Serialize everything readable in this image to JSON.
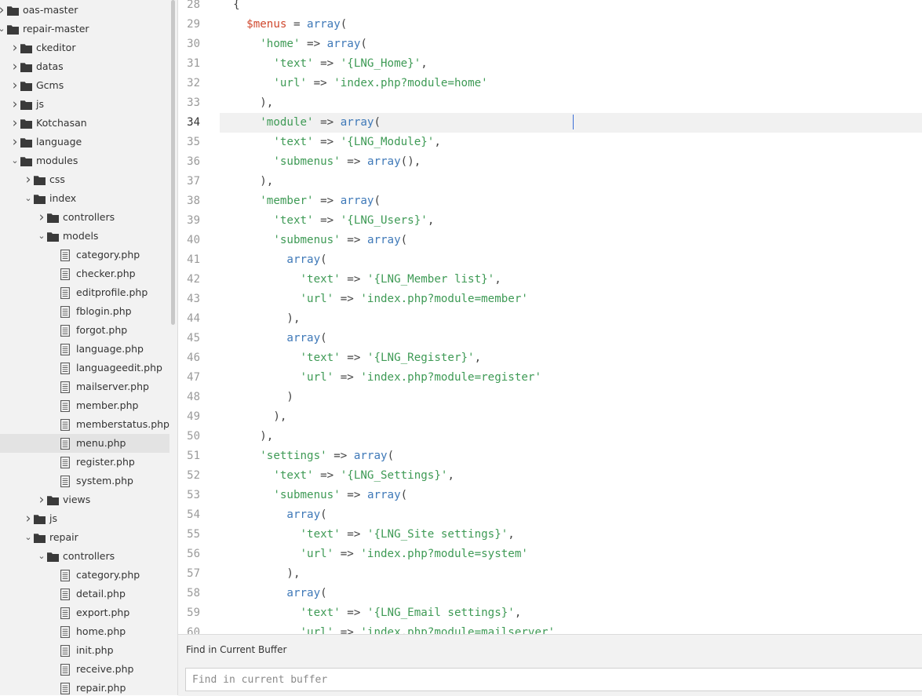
{
  "sidebar": {
    "tree": [
      {
        "label": "oas-master",
        "type": "folder",
        "depth": 0,
        "arrow": "right"
      },
      {
        "label": "repair-master",
        "type": "folder",
        "depth": 0,
        "arrow": "down"
      },
      {
        "label": "ckeditor",
        "type": "folder",
        "depth": 1,
        "arrow": "right"
      },
      {
        "label": "datas",
        "type": "folder",
        "depth": 1,
        "arrow": "right"
      },
      {
        "label": "Gcms",
        "type": "folder",
        "depth": 1,
        "arrow": "right"
      },
      {
        "label": "js",
        "type": "folder",
        "depth": 1,
        "arrow": "right"
      },
      {
        "label": "Kotchasan",
        "type": "folder",
        "depth": 1,
        "arrow": "right"
      },
      {
        "label": "language",
        "type": "folder",
        "depth": 1,
        "arrow": "right"
      },
      {
        "label": "modules",
        "type": "folder",
        "depth": 1,
        "arrow": "down"
      },
      {
        "label": "css",
        "type": "folder",
        "depth": 2,
        "arrow": "right"
      },
      {
        "label": "index",
        "type": "folder",
        "depth": 2,
        "arrow": "down"
      },
      {
        "label": "controllers",
        "type": "folder",
        "depth": 3,
        "arrow": "right"
      },
      {
        "label": "models",
        "type": "folder",
        "depth": 3,
        "arrow": "down"
      },
      {
        "label": "category.php",
        "type": "file",
        "depth": 4
      },
      {
        "label": "checker.php",
        "type": "file",
        "depth": 4
      },
      {
        "label": "editprofile.php",
        "type": "file",
        "depth": 4
      },
      {
        "label": "fblogin.php",
        "type": "file",
        "depth": 4
      },
      {
        "label": "forgot.php",
        "type": "file",
        "depth": 4
      },
      {
        "label": "language.php",
        "type": "file",
        "depth": 4
      },
      {
        "label": "languageedit.php",
        "type": "file",
        "depth": 4
      },
      {
        "label": "mailserver.php",
        "type": "file",
        "depth": 4
      },
      {
        "label": "member.php",
        "type": "file",
        "depth": 4
      },
      {
        "label": "memberstatus.php",
        "type": "file",
        "depth": 4
      },
      {
        "label": "menu.php",
        "type": "file",
        "depth": 4,
        "selected": true
      },
      {
        "label": "register.php",
        "type": "file",
        "depth": 4
      },
      {
        "label": "system.php",
        "type": "file",
        "depth": 4
      },
      {
        "label": "views",
        "type": "folder",
        "depth": 3,
        "arrow": "right"
      },
      {
        "label": "js",
        "type": "folder",
        "depth": 2,
        "arrow": "right"
      },
      {
        "label": "repair",
        "type": "folder",
        "depth": 2,
        "arrow": "down"
      },
      {
        "label": "controllers",
        "type": "folder",
        "depth": 3,
        "arrow": "down"
      },
      {
        "label": "category.php",
        "type": "file",
        "depth": 4
      },
      {
        "label": "detail.php",
        "type": "file",
        "depth": 4
      },
      {
        "label": "export.php",
        "type": "file",
        "depth": 4
      },
      {
        "label": "home.php",
        "type": "file",
        "depth": 4
      },
      {
        "label": "init.php",
        "type": "file",
        "depth": 4
      },
      {
        "label": "receive.php",
        "type": "file",
        "depth": 4
      },
      {
        "label": "repair.php",
        "type": "file",
        "depth": 4
      }
    ]
  },
  "editor": {
    "active_line": 34,
    "lines": [
      {
        "n": "28",
        "t": [
          [
            "p",
            "  {"
          ]
        ]
      },
      {
        "n": "29",
        "t": [
          [
            "p",
            "    "
          ],
          [
            "v",
            "$menus"
          ],
          [
            "p",
            " = "
          ],
          [
            "f",
            "array"
          ],
          [
            "p",
            "("
          ]
        ]
      },
      {
        "n": "30",
        "t": [
          [
            "p",
            "      "
          ],
          [
            "s",
            "'home'"
          ],
          [
            "p",
            " => "
          ],
          [
            "f",
            "array"
          ],
          [
            "p",
            "("
          ]
        ]
      },
      {
        "n": "31",
        "t": [
          [
            "p",
            "        "
          ],
          [
            "s",
            "'text'"
          ],
          [
            "p",
            " => "
          ],
          [
            "s",
            "'{LNG_Home}'"
          ],
          [
            "p",
            ","
          ]
        ]
      },
      {
        "n": "32",
        "t": [
          [
            "p",
            "        "
          ],
          [
            "s",
            "'url'"
          ],
          [
            "p",
            " => "
          ],
          [
            "s",
            "'index.php?module=home'"
          ]
        ]
      },
      {
        "n": "33",
        "t": [
          [
            "p",
            "      ),"
          ]
        ]
      },
      {
        "n": "34",
        "t": [
          [
            "p",
            "      "
          ],
          [
            "s",
            "'module'"
          ],
          [
            "p",
            " => "
          ],
          [
            "f",
            "array"
          ],
          [
            "p",
            "("
          ]
        ]
      },
      {
        "n": "35",
        "t": [
          [
            "p",
            "        "
          ],
          [
            "s",
            "'text'"
          ],
          [
            "p",
            " => "
          ],
          [
            "s",
            "'{LNG_Module}'"
          ],
          [
            "p",
            ","
          ]
        ]
      },
      {
        "n": "36",
        "t": [
          [
            "p",
            "        "
          ],
          [
            "s",
            "'submenus'"
          ],
          [
            "p",
            " => "
          ],
          [
            "f",
            "array"
          ],
          [
            "p",
            "(),"
          ]
        ]
      },
      {
        "n": "37",
        "t": [
          [
            "p",
            "      ),"
          ]
        ]
      },
      {
        "n": "38",
        "t": [
          [
            "p",
            "      "
          ],
          [
            "s",
            "'member'"
          ],
          [
            "p",
            " => "
          ],
          [
            "f",
            "array"
          ],
          [
            "p",
            "("
          ]
        ]
      },
      {
        "n": "39",
        "t": [
          [
            "p",
            "        "
          ],
          [
            "s",
            "'text'"
          ],
          [
            "p",
            " => "
          ],
          [
            "s",
            "'{LNG_Users}'"
          ],
          [
            "p",
            ","
          ]
        ]
      },
      {
        "n": "40",
        "t": [
          [
            "p",
            "        "
          ],
          [
            "s",
            "'submenus'"
          ],
          [
            "p",
            " => "
          ],
          [
            "f",
            "array"
          ],
          [
            "p",
            "("
          ]
        ]
      },
      {
        "n": "41",
        "t": [
          [
            "p",
            "          "
          ],
          [
            "f",
            "array"
          ],
          [
            "p",
            "("
          ]
        ]
      },
      {
        "n": "42",
        "t": [
          [
            "p",
            "            "
          ],
          [
            "s",
            "'text'"
          ],
          [
            "p",
            " => "
          ],
          [
            "s",
            "'{LNG_Member list}'"
          ],
          [
            "p",
            ","
          ]
        ]
      },
      {
        "n": "43",
        "t": [
          [
            "p",
            "            "
          ],
          [
            "s",
            "'url'"
          ],
          [
            "p",
            " => "
          ],
          [
            "s",
            "'index.php?module=member'"
          ]
        ]
      },
      {
        "n": "44",
        "t": [
          [
            "p",
            "          ),"
          ]
        ]
      },
      {
        "n": "45",
        "t": [
          [
            "p",
            "          "
          ],
          [
            "f",
            "array"
          ],
          [
            "p",
            "("
          ]
        ]
      },
      {
        "n": "46",
        "t": [
          [
            "p",
            "            "
          ],
          [
            "s",
            "'text'"
          ],
          [
            "p",
            " => "
          ],
          [
            "s",
            "'{LNG_Register}'"
          ],
          [
            "p",
            ","
          ]
        ]
      },
      {
        "n": "47",
        "t": [
          [
            "p",
            "            "
          ],
          [
            "s",
            "'url'"
          ],
          [
            "p",
            " => "
          ],
          [
            "s",
            "'index.php?module=register'"
          ]
        ]
      },
      {
        "n": "48",
        "t": [
          [
            "p",
            "          )"
          ]
        ]
      },
      {
        "n": "49",
        "t": [
          [
            "p",
            "        ),"
          ]
        ]
      },
      {
        "n": "50",
        "t": [
          [
            "p",
            "      ),"
          ]
        ]
      },
      {
        "n": "51",
        "t": [
          [
            "p",
            "      "
          ],
          [
            "s",
            "'settings'"
          ],
          [
            "p",
            " => "
          ],
          [
            "f",
            "array"
          ],
          [
            "p",
            "("
          ]
        ]
      },
      {
        "n": "52",
        "t": [
          [
            "p",
            "        "
          ],
          [
            "s",
            "'text'"
          ],
          [
            "p",
            " => "
          ],
          [
            "s",
            "'{LNG_Settings}'"
          ],
          [
            "p",
            ","
          ]
        ]
      },
      {
        "n": "53",
        "t": [
          [
            "p",
            "        "
          ],
          [
            "s",
            "'submenus'"
          ],
          [
            "p",
            " => "
          ],
          [
            "f",
            "array"
          ],
          [
            "p",
            "("
          ]
        ]
      },
      {
        "n": "54",
        "t": [
          [
            "p",
            "          "
          ],
          [
            "f",
            "array"
          ],
          [
            "p",
            "("
          ]
        ]
      },
      {
        "n": "55",
        "t": [
          [
            "p",
            "            "
          ],
          [
            "s",
            "'text'"
          ],
          [
            "p",
            " => "
          ],
          [
            "s",
            "'{LNG_Site settings}'"
          ],
          [
            "p",
            ","
          ]
        ]
      },
      {
        "n": "56",
        "t": [
          [
            "p",
            "            "
          ],
          [
            "s",
            "'url'"
          ],
          [
            "p",
            " => "
          ],
          [
            "s",
            "'index.php?module=system'"
          ]
        ]
      },
      {
        "n": "57",
        "t": [
          [
            "p",
            "          ),"
          ]
        ]
      },
      {
        "n": "58",
        "t": [
          [
            "p",
            "          "
          ],
          [
            "f",
            "array"
          ],
          [
            "p",
            "("
          ]
        ]
      },
      {
        "n": "59",
        "t": [
          [
            "p",
            "            "
          ],
          [
            "s",
            "'text'"
          ],
          [
            "p",
            " => "
          ],
          [
            "s",
            "'{LNG_Email settings}'"
          ],
          [
            "p",
            ","
          ]
        ]
      },
      {
        "n": "60",
        "t": [
          [
            "p",
            "            "
          ],
          [
            "s",
            "'url'"
          ],
          [
            "p",
            " => "
          ],
          [
            "s",
            "'index.php?module=mailserver'"
          ]
        ]
      }
    ]
  },
  "find": {
    "title": "Find in Current Buffer",
    "placeholder": "Find in current buffer"
  },
  "colors": {
    "string": "#3e9a55",
    "function": "#3f79b8",
    "variable": "#d0492f",
    "cursor": "#3b6fd6"
  }
}
